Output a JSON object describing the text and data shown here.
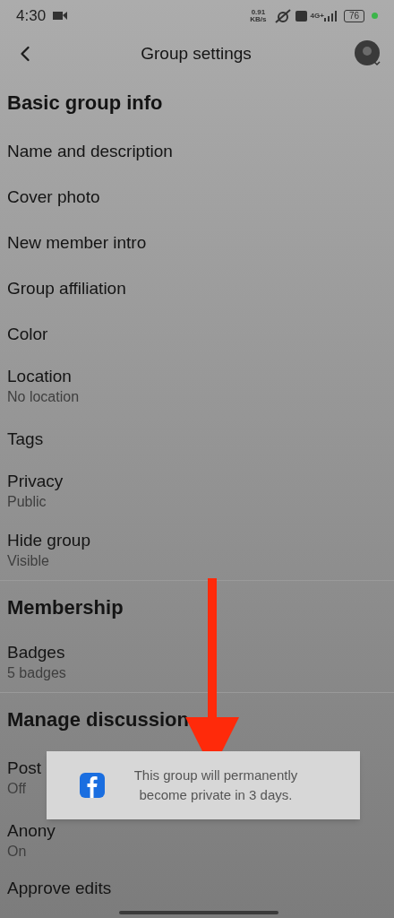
{
  "status_bar": {
    "time": "4:30",
    "speed": "0.91",
    "speed_unit": "KB/s",
    "network": "4G+",
    "battery": "76"
  },
  "header": {
    "title": "Group settings"
  },
  "sections": [
    {
      "heading": "Basic group info",
      "items": [
        {
          "label": "Name and description"
        },
        {
          "label": "Cover photo"
        },
        {
          "label": "New member intro"
        },
        {
          "label": "Group affiliation"
        },
        {
          "label": "Color"
        },
        {
          "label": "Location",
          "value": "No location"
        },
        {
          "label": "Tags"
        },
        {
          "label": "Privacy",
          "value": "Public"
        },
        {
          "label": "Hide group",
          "value": "Visible"
        }
      ]
    },
    {
      "heading": "Membership",
      "items": [
        {
          "label": "Badges",
          "value": "5 badges"
        }
      ]
    },
    {
      "heading": "Manage discussion",
      "items": [
        {
          "label": "Post",
          "value": "Off"
        },
        {
          "label": "Anony",
          "value": "On"
        },
        {
          "label": "Approve edits"
        }
      ]
    }
  ],
  "toast": {
    "message": "This group will permanently become private in 3 days."
  }
}
